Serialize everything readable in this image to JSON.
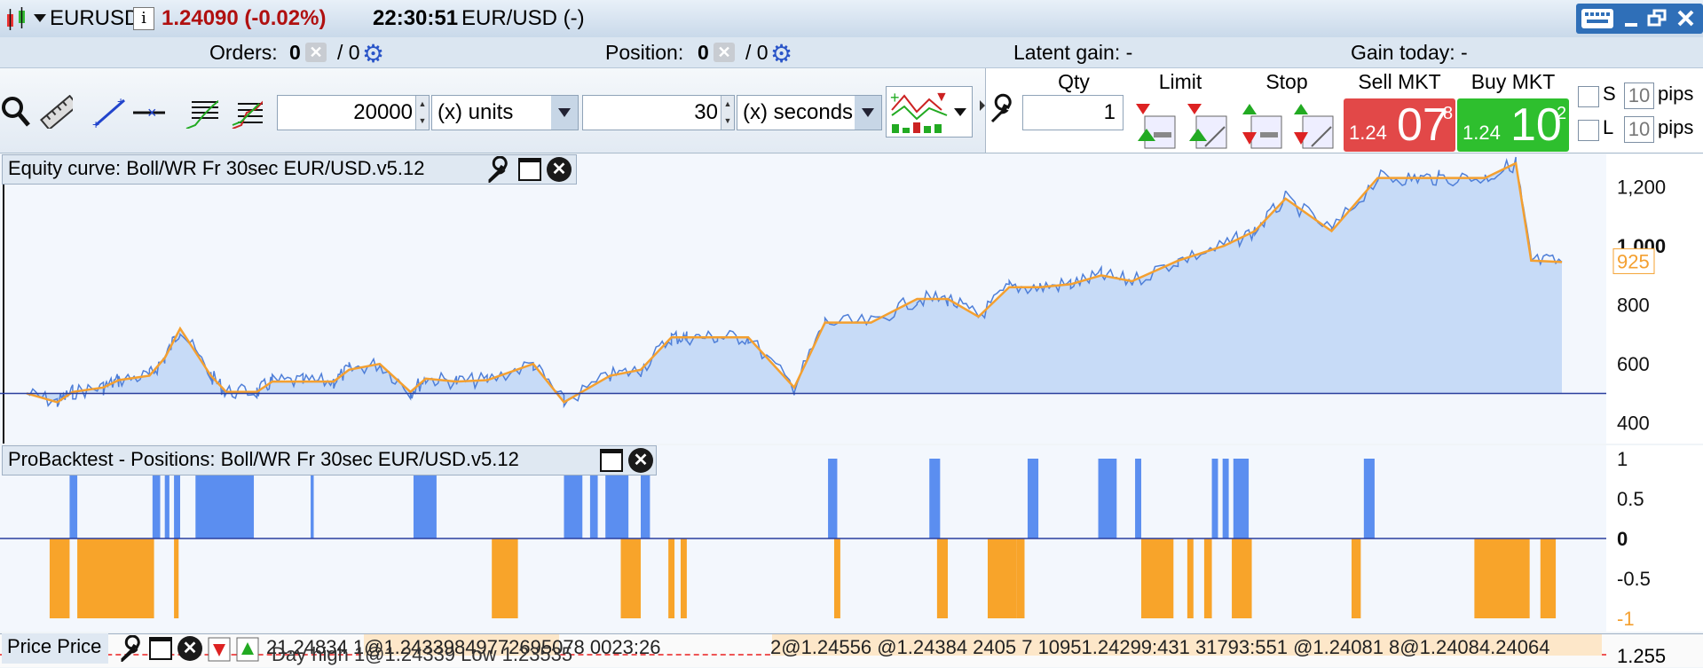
{
  "titlebar": {
    "symbol": "EURUSD",
    "info_icon": "i",
    "price_change": "1.24090 (-0.02%)",
    "time": "22:30:51",
    "instrument": "EUR/USD (-)",
    "colors": {
      "price_change": "#b01010"
    }
  },
  "stats": {
    "orders_label": "Orders:",
    "orders_value": "0",
    "orders_sep": "/ 0",
    "position_label": "Position:",
    "position_value": "0",
    "position_sep": "/ 0",
    "latent_gain": "Latent gain: -",
    "gain_today": "Gain today: -"
  },
  "toolbar": {
    "quantity_value": "20000",
    "quantity_unit": "(x) units",
    "period_value": "30",
    "period_unit": "(x) seconds",
    "qty_header": "Qty",
    "qty_value": "1",
    "limit_header": "Limit",
    "stop_header": "Stop",
    "sell_header": "Sell MKT",
    "buy_header": "Buy MKT",
    "sell_price": {
      "prefix": "1.24",
      "big": "07",
      "sup": "8"
    },
    "buy_price": {
      "prefix": "1.24",
      "big": "10",
      "sup": "2"
    },
    "s_label": "S",
    "s_pips": "10",
    "l_label": "L",
    "l_pips": "10",
    "pips_label": "pips",
    "colors": {
      "sell": "#e24848",
      "buy": "#2ebf2e"
    }
  },
  "equity_panel": {
    "title": "Equity curve: Boll/WR Fr 30sec EUR/USD.v5.12",
    "current_value_label": "925"
  },
  "positions_panel": {
    "title": "ProBacktest - Positions: Boll/WR Fr 30sec EUR/USD.v5.12"
  },
  "price_panel": {
    "title": "Price Price",
    "overlay_text": "Day high 1@1.24339 Low 1.23535",
    "trade_text_left": "21.24834 1@1.24339849772695078 0023:26",
    "trade_text_right": "2@1.24556 @1.24384 2405 7 10951.24299:431 31793:551 @1.24081 8@1.24084.24064",
    "axis_value": "1.255"
  },
  "chart_data": [
    {
      "type": "area",
      "title": "Equity curve: Boll/WR Fr 30sec EUR/USD.v5.12",
      "ylim": [
        330,
        1310
      ],
      "yticks": [
        "1,200",
        "1,000",
        "800",
        "600",
        "400"
      ],
      "ytick_values": [
        1200,
        1000,
        800,
        600,
        400
      ],
      "baseline": 500,
      "x": [
        0,
        2,
        3,
        5,
        6,
        8,
        9,
        10,
        12,
        13,
        15,
        16,
        18,
        20,
        21,
        23,
        25,
        26,
        28,
        30,
        33,
        35,
        38,
        40,
        42,
        43,
        45,
        47,
        50,
        52,
        55,
        58,
        60,
        62,
        64,
        66,
        68,
        70,
        72,
        75,
        78,
        80,
        82,
        85,
        88,
        90,
        92,
        95,
        97,
        98,
        100
      ],
      "values": [
        500,
        470,
        505,
        520,
        545,
        560,
        620,
        720,
        560,
        505,
        505,
        540,
        540,
        540,
        580,
        600,
        505,
        550,
        540,
        545,
        600,
        470,
        560,
        580,
        690,
        690,
        690,
        690,
        520,
        740,
        740,
        820,
        820,
        760,
        860,
        860,
        870,
        900,
        880,
        950,
        1000,
        1050,
        1160,
        1050,
        1230,
        1230,
        1230,
        1230,
        1280,
        950,
        945
      ],
      "colors": {
        "line": "#f4a030",
        "fill": "#c7dbf7",
        "noise": "#4f7fd8",
        "baseline": "#2a3f9e"
      }
    },
    {
      "type": "bar",
      "title": "ProBacktest - Positions: Boll/WR Fr 30sec EUR/USD.v5.12",
      "ylim": [
        -1.1,
        1.1
      ],
      "yticks": [
        "1",
        "0.5",
        "0",
        "-0.5",
        "-1"
      ],
      "ytick_values": [
        1,
        0.5,
        0,
        -0.5,
        -1
      ],
      "long_segments": [
        [
          2.8,
          3.3
        ],
        [
          8.2,
          8.7
        ],
        [
          9.0,
          9.3
        ],
        [
          9.6,
          10.0
        ],
        [
          11.0,
          14.8
        ],
        [
          18.5,
          18.7
        ],
        [
          25.2,
          26.7
        ],
        [
          35.0,
          36.2
        ],
        [
          36.7,
          37.2
        ],
        [
          37.7,
          39.2
        ],
        [
          40.0,
          40.6
        ],
        [
          52.2,
          52.8
        ],
        [
          58.8,
          59.5
        ],
        [
          65.2,
          65.9
        ],
        [
          69.8,
          71.0
        ],
        [
          72.2,
          72.6
        ],
        [
          77.2,
          77.6
        ],
        [
          77.9,
          78.3
        ],
        [
          78.6,
          79.6
        ],
        [
          87.1,
          87.8
        ]
      ],
      "short_segments": [
        [
          1.5,
          2.8
        ],
        [
          3.3,
          8.3
        ],
        [
          9.6,
          9.9
        ],
        [
          30.3,
          32.0
        ],
        [
          38.7,
          40.0
        ],
        [
          41.8,
          42.2
        ],
        [
          42.6,
          43.0
        ],
        [
          52.6,
          53.0
        ],
        [
          59.3,
          60.0
        ],
        [
          62.6,
          64.5
        ],
        [
          64.5,
          65.0
        ],
        [
          72.6,
          74.7
        ],
        [
          75.6,
          76.0
        ],
        [
          76.7,
          77.2
        ],
        [
          78.5,
          79.8
        ],
        [
          86.3,
          86.9
        ],
        [
          94.3,
          97.9
        ],
        [
          98.6,
          99.6
        ]
      ],
      "colors": {
        "long": "#5b8ef0",
        "short": "#f8a42a",
        "zero": "#2a3f9e"
      }
    }
  ]
}
